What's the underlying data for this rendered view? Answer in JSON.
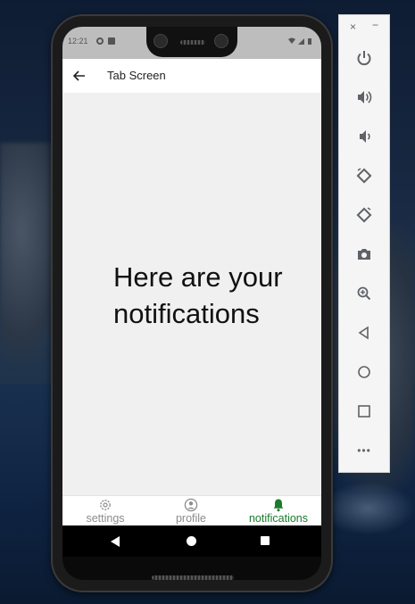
{
  "status_bar": {
    "time": "12:21"
  },
  "app_bar": {
    "title": "Tab Screen"
  },
  "content": {
    "message": "Here are your notifications"
  },
  "tabs": [
    {
      "label": "settings",
      "icon": "gear-icon",
      "active": false
    },
    {
      "label": "profile",
      "icon": "account-circle-icon",
      "active": false
    },
    {
      "label": "notifications",
      "icon": "bell-icon",
      "active": true
    }
  ],
  "colors": {
    "active_tab": "#1b7a2c",
    "inactive_tab": "#8c8c8c",
    "content_bg": "#f0f0f0",
    "toolbar_icon": "#5f6368"
  },
  "emulator_toolbar": {
    "window_controls": {
      "close": "×",
      "minimize": "−"
    },
    "buttons": [
      "power-icon",
      "volume-up-icon",
      "volume-down-icon",
      "rotate-left-icon",
      "rotate-right-icon",
      "camera-icon",
      "zoom-icon",
      "back-icon",
      "home-icon",
      "overview-icon",
      "more-icon"
    ],
    "more_glyph": "•••"
  }
}
